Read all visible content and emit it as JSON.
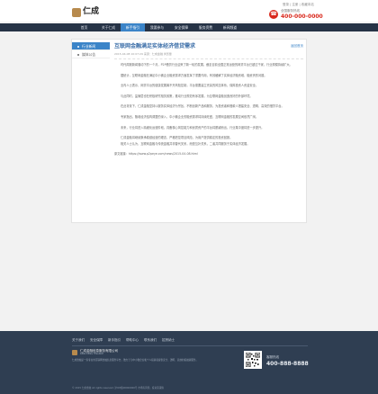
{
  "header": {
    "logo_text": "仁成",
    "top_links": "登录 | 注册 | 收藏本站",
    "hotline_label": "全国服务热线",
    "hotline_number": "400-000-0000"
  },
  "nav": {
    "items": [
      "首页",
      "关于仁成",
      "新手指引",
      "我要参与",
      "安全保障",
      "服务资费",
      "新闻频道"
    ],
    "active_index": 2
  },
  "sidebar": {
    "items": [
      "行业新闻",
      "媒体公告"
    ]
  },
  "article": {
    "breadcrumb": "返回首页",
    "title": "互联网金融满足实体经济借贷需求",
    "meta": "2015-04-08 10:07:29  来源：仁成金融 浏览量",
    "paragraphs": [
      "时代周报新闻驱动下的一个月，P2P借贷行业迎来了新一轮的发展，截至目前全国正常运营的网贷平台已超过千家，行业规模持续扩大。",
      "据统计，互联网金融在满足中小微企业融资需求方面发挥了重要作用，有效缓解了实体经济融资难、融资贵的问题。",
      "业内人士表示，网贷平台的健康发展离不开风险控制，平台需要建立完善的风控体系，保障投资人资金安全。",
      "与此同时，监管层也在积极研究相关政策，推动行业规范有序发展，为互联网金融创造良好的外部环境。",
      "在此背景下，仁成金融坚持以服务实体经济为宗旨，不断创新产品和服务，为投资者和借款人搭建安全、透明、高效的借贷平台。",
      "专家指出，随着经济结构调整的深入，中小微企业的融资需求将持续旺盛，互联网金融的发展空间依然广阔。",
      "未来，行业将进入精细化运营阶段，具备核心风控能力和优质资产的平台将脱颖而出，行业集中度将进一步提升。",
      "仁成金融将继续秉承稳健经营的理念，严格把控项目风险，为用户提供稳定的投资回报。",
      "相关人士认为，互联网金融与传统金融并非替代关系，而是互补关系，二者共同服务于实体经济发展。"
    ],
    "source": "原文链接：https://www.p2peye.com/news/2015-04-08.html"
  },
  "footer": {
    "links": [
      "关于我们",
      "安全保障",
      "新手指引",
      "帮助中心",
      "联系我们",
      "招贤纳士"
    ],
    "company_name": "仁成金融信息服务有限公司",
    "company_sub": "RENCHENG FINANCE",
    "description": "仁成金融是一家专业的互联网金融信息服务平台，致力于为中小微企业和个人投资者提供安全、透明、高效的投融资服务。",
    "contact_label": "客服热线",
    "contact_number": "400-888-8888",
    "copyright": "© 2015 仁成金融 All rights reserved. 沪ICP备00000000号 市场有风险，投资需谨慎"
  }
}
